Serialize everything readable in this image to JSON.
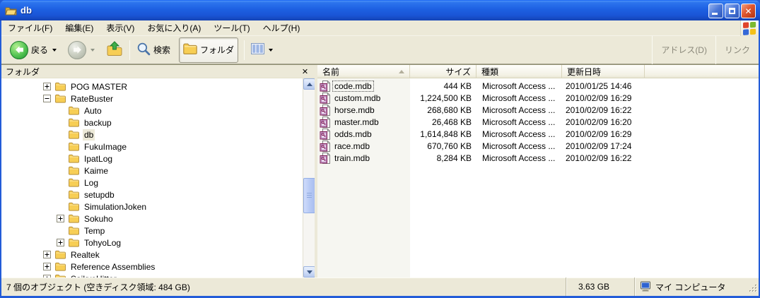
{
  "window": {
    "title": "db",
    "buttons": {
      "minimize": "minimize",
      "maximize": "maximize",
      "close": "close"
    }
  },
  "menubar": {
    "items": [
      "ファイル(F)",
      "編集(E)",
      "表示(V)",
      "お気に入り(A)",
      "ツール(T)",
      "ヘルプ(H)"
    ]
  },
  "toolbar": {
    "back_label": "戻る",
    "search_label": "検索",
    "folders_label": "フォルダ",
    "address_label": "アドレス(D)",
    "links_label": "リンク"
  },
  "folders_panel": {
    "title": "フォルダ",
    "close_glyph": "✕",
    "tree": [
      {
        "label": "POG MASTER",
        "level": 1,
        "expander": "plus",
        "selected": false
      },
      {
        "label": "RateBuster",
        "level": 1,
        "expander": "minus",
        "selected": false
      },
      {
        "label": "Auto",
        "level": 2,
        "expander": "none",
        "selected": false
      },
      {
        "label": "backup",
        "level": 2,
        "expander": "none",
        "selected": false
      },
      {
        "label": "db",
        "level": 2,
        "expander": "none",
        "selected": true
      },
      {
        "label": "FukuImage",
        "level": 2,
        "expander": "none",
        "selected": false
      },
      {
        "label": "IpatLog",
        "level": 2,
        "expander": "none",
        "selected": false
      },
      {
        "label": "Kaime",
        "level": 2,
        "expander": "none",
        "selected": false
      },
      {
        "label": "Log",
        "level": 2,
        "expander": "none",
        "selected": false
      },
      {
        "label": "setupdb",
        "level": 2,
        "expander": "none",
        "selected": false
      },
      {
        "label": "SimulationJoken",
        "level": 2,
        "expander": "none",
        "selected": false
      },
      {
        "label": "Sokuho",
        "level": 2,
        "expander": "plus",
        "selected": false
      },
      {
        "label": "Temp",
        "level": 2,
        "expander": "none",
        "selected": false
      },
      {
        "label": "TohyoLog",
        "level": 2,
        "expander": "plus",
        "selected": false
      },
      {
        "label": "Realtek",
        "level": 1,
        "expander": "plus",
        "selected": false
      },
      {
        "label": "Reference Assemblies",
        "level": 1,
        "expander": "plus",
        "selected": false
      },
      {
        "label": "SaikyoHitter",
        "level": 1,
        "expander": "plus",
        "selected": false,
        "clipped": true
      }
    ]
  },
  "filelist": {
    "columns": [
      {
        "label": "名前",
        "sort": "asc",
        "align": "left"
      },
      {
        "label": "サイズ",
        "align": "right"
      },
      {
        "label": "種類",
        "align": "left"
      },
      {
        "label": "更新日時",
        "align": "left"
      }
    ],
    "rows": [
      {
        "name": "code.mdb",
        "size": "444 KB",
        "type": "Microsoft Access ...",
        "date": "2010/01/25 14:46",
        "focused": true
      },
      {
        "name": "custom.mdb",
        "size": "1,224,500 KB",
        "type": "Microsoft Access ...",
        "date": "2010/02/09 16:29",
        "focused": false
      },
      {
        "name": "horse.mdb",
        "size": "268,680 KB",
        "type": "Microsoft Access ...",
        "date": "2010/02/09 16:22",
        "focused": false
      },
      {
        "name": "master.mdb",
        "size": "26,468 KB",
        "type": "Microsoft Access ...",
        "date": "2010/02/09 16:20",
        "focused": false
      },
      {
        "name": "odds.mdb",
        "size": "1,614,848 KB",
        "type": "Microsoft Access ...",
        "date": "2010/02/09 16:29",
        "focused": false
      },
      {
        "name": "race.mdb",
        "size": "670,760 KB",
        "type": "Microsoft Access ...",
        "date": "2010/02/09 17:24",
        "focused": false
      },
      {
        "name": "train.mdb",
        "size": "8,284 KB",
        "type": "Microsoft Access ...",
        "date": "2010/02/09 16:22",
        "focused": false
      }
    ]
  },
  "statusbar": {
    "objects_text": "7 個のオブジェクト (空きディスク領域: 484 GB)",
    "size_text": "3.63 GB",
    "location_text": "マイ コンピュータ"
  },
  "colors": {
    "titlebar_blue": "#1d60e2",
    "window_frame": "#235cd8",
    "chrome_tan": "#ece9d8",
    "close_button_red": "#e0572f",
    "inactive_selection": "#ece9d8",
    "folder_yellow": "#f7ce55",
    "mdb_icon_purple": "#7a1150",
    "sorted_column_tint": "#f6f6f1"
  }
}
